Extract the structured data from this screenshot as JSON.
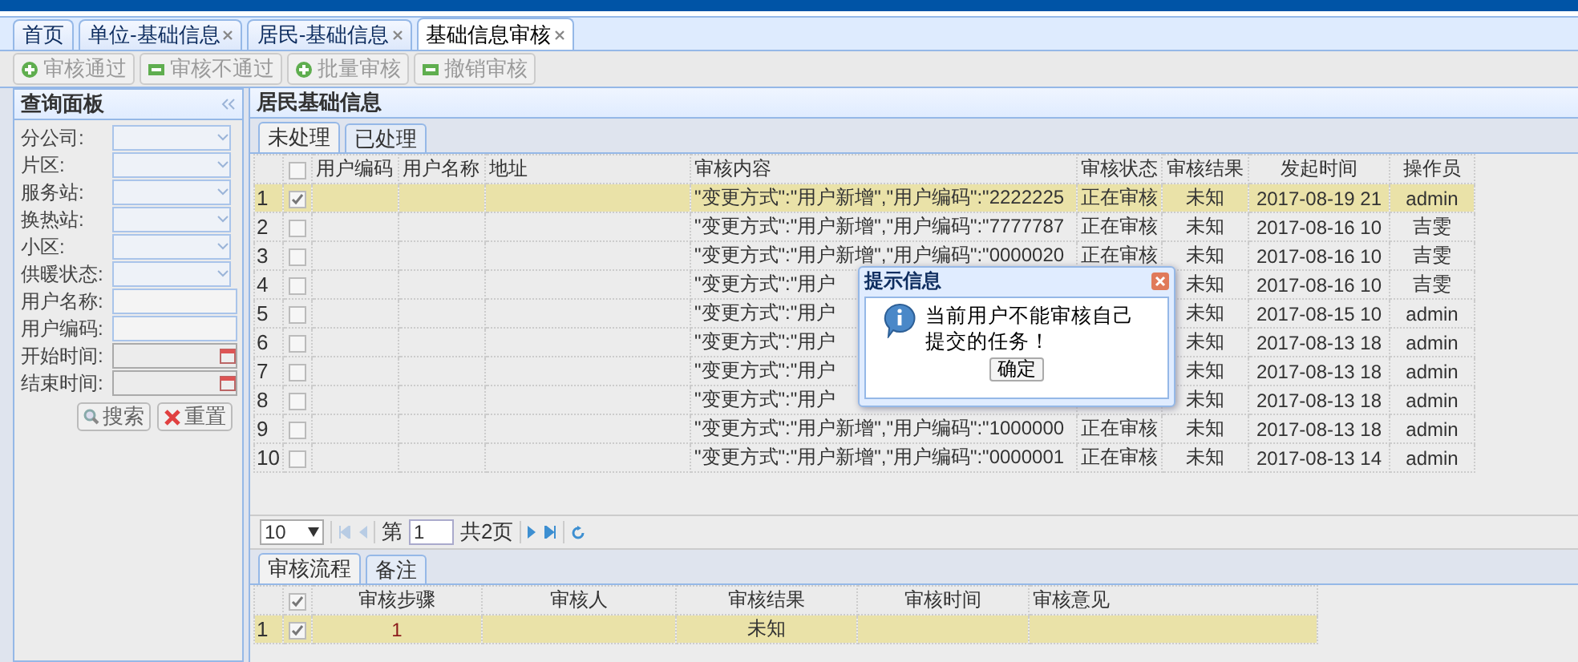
{
  "tabs": [
    {
      "label": "首页",
      "closable": false,
      "selected": false
    },
    {
      "label": "单位-基础信息",
      "closable": true,
      "selected": false
    },
    {
      "label": "居民-基础信息",
      "closable": true,
      "selected": false
    },
    {
      "label": "基础信息审核",
      "closable": true,
      "selected": true
    }
  ],
  "toolbar": [
    {
      "label": "审核通过",
      "kind": "add",
      "disabled": true
    },
    {
      "label": "审核不通过",
      "kind": "remove",
      "disabled": true
    },
    {
      "label": "批量审核",
      "kind": "add",
      "disabled": true
    },
    {
      "label": "撤销审核",
      "kind": "remove",
      "disabled": true
    }
  ],
  "query_panel": {
    "title": "查询面板",
    "fields": [
      {
        "label": "分公司:",
        "kind": "select"
      },
      {
        "label": "片区:",
        "kind": "select"
      },
      {
        "label": "服务站:",
        "kind": "select"
      },
      {
        "label": "换热站:",
        "kind": "select"
      },
      {
        "label": "小区:",
        "kind": "select"
      },
      {
        "label": "供暖状态:",
        "kind": "select"
      },
      {
        "label": "用户名称:",
        "kind": "text"
      },
      {
        "label": "用户编码:",
        "kind": "text"
      },
      {
        "label": "开始时间:",
        "kind": "date"
      },
      {
        "label": "结束时间:",
        "kind": "date"
      }
    ],
    "buttons": [
      {
        "label": "搜索",
        "kind": "search"
      },
      {
        "label": "重置",
        "kind": "reset"
      }
    ]
  },
  "main_panel": {
    "title": "居民基础信息",
    "tabs": [
      {
        "label": "未处理",
        "selected": true
      },
      {
        "label": "已处理",
        "selected": false
      }
    ],
    "table": {
      "header_checked": false,
      "columns": [
        "用户编码",
        "用户名称",
        "地址",
        "审核内容",
        "审核状态",
        "审核结果",
        "发起时间",
        "操作员"
      ],
      "rows": [
        {
          "num": "1",
          "checked": true,
          "selected": true,
          "content": "\"变更方式\":\"用户新增\",\"用户编码\":\"2222225",
          "status": "正在审核",
          "result": "未知",
          "time": "2017-08-19 21",
          "operator": "admin"
        },
        {
          "num": "2",
          "checked": false,
          "selected": false,
          "content": "\"变更方式\":\"用户新增\",\"用户编码\":\"7777787",
          "status": "正在审核",
          "result": "未知",
          "time": "2017-08-16 10",
          "operator": "吉雯"
        },
        {
          "num": "3",
          "checked": false,
          "selected": false,
          "content": "\"变更方式\":\"用户新增\",\"用户编码\":\"0000020",
          "status": "正在审核",
          "result": "未知",
          "time": "2017-08-16 10",
          "operator": "吉雯"
        },
        {
          "num": "4",
          "checked": false,
          "selected": false,
          "content": "\"变更方式\":\"用户",
          "result": "未知",
          "time": "2017-08-16 10",
          "operator": "吉雯"
        },
        {
          "num": "5",
          "checked": false,
          "selected": false,
          "content": "\"变更方式\":\"用户",
          "result": "未知",
          "time": "2017-08-15 10",
          "operator": "admin"
        },
        {
          "num": "6",
          "checked": false,
          "selected": false,
          "content": "\"变更方式\":\"用户",
          "result": "未知",
          "time": "2017-08-13 18",
          "operator": "admin"
        },
        {
          "num": "7",
          "checked": false,
          "selected": false,
          "content": "\"变更方式\":\"用户",
          "result": "未知",
          "time": "2017-08-13 18",
          "operator": "admin"
        },
        {
          "num": "8",
          "checked": false,
          "selected": false,
          "content": "\"变更方式\":\"用户",
          "result": "未知",
          "time": "2017-08-13 18",
          "operator": "admin"
        },
        {
          "num": "9",
          "checked": false,
          "selected": false,
          "content": "\"变更方式\":\"用户新增\",\"用户编码\":\"1000000",
          "status": "正在审核",
          "result": "未知",
          "time": "2017-08-13 18",
          "operator": "admin"
        },
        {
          "num": "10",
          "checked": false,
          "selected": false,
          "content": "\"变更方式\":\"用户新增\",\"用户编码\":\"0000001",
          "status": "正在审核",
          "result": "未知",
          "time": "2017-08-13 14",
          "operator": "admin"
        }
      ]
    },
    "pagination": {
      "page_size": "10",
      "page_prefix": "第",
      "page": "1",
      "page_total": "共2页"
    }
  },
  "detail": {
    "tabs": [
      {
        "label": "审核流程",
        "selected": true
      },
      {
        "label": "备注",
        "selected": false
      }
    ],
    "table": {
      "header_checked": true,
      "columns": [
        "审核步骤",
        "审核人",
        "审核结果",
        "审核时间",
        "审核意见"
      ],
      "rows": [
        {
          "num": "1",
          "checked": true,
          "selected": true,
          "step": "1",
          "result": "未知"
        }
      ]
    }
  },
  "dialog": {
    "title": "提示信息",
    "message": "当前用户不能审核自己提交的任务！",
    "button": "确定"
  }
}
